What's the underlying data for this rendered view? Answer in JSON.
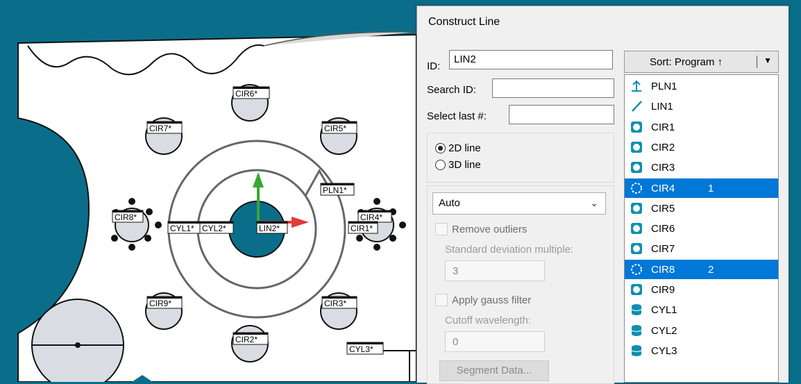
{
  "cad_view": {
    "feature_labels": [
      "CIR6*",
      "CIR7*",
      "CIR5*",
      "PLN1*",
      "CIR8*",
      "CYL1*",
      "CYL2*",
      "LIN2*",
      "CIR4*",
      "CIR1*",
      "CIR9*",
      "CIR3*",
      "CIR2*",
      "CYL3*"
    ]
  },
  "dialog": {
    "title": "Construct Line",
    "id_label": "ID:",
    "id_value": "LIN2",
    "search_label": "Search ID:",
    "search_value": "",
    "select_last_label": "Select last #:",
    "select_last_value": "",
    "radio_2d": "2D line",
    "radio_3d": "3D line",
    "selected_mode": "2D line",
    "fit_method": "Auto",
    "remove_outliers": "Remove outliers",
    "std_dev_label": "Standard deviation multiple:",
    "std_dev_value": "3",
    "gauss_filter": "Apply gauss filter",
    "cutoff_label": "Cutoff wavelength:",
    "cutoff_value": "0",
    "segment_button": "Segment Data...",
    "sort_label": "Sort: Program ↑"
  },
  "features": [
    {
      "name": "PLN1",
      "icon": "plane-icon",
      "order": "",
      "selected": false
    },
    {
      "name": "LIN1",
      "icon": "line-icon",
      "order": "",
      "selected": false
    },
    {
      "name": "CIR1",
      "icon": "circle-icon",
      "order": "",
      "selected": false
    },
    {
      "name": "CIR2",
      "icon": "circle-icon",
      "order": "",
      "selected": false
    },
    {
      "name": "CIR3",
      "icon": "circle-icon",
      "order": "",
      "selected": false
    },
    {
      "name": "CIR4",
      "icon": "circle-icon",
      "order": "1",
      "selected": true
    },
    {
      "name": "CIR5",
      "icon": "circle-icon",
      "order": "",
      "selected": false
    },
    {
      "name": "CIR6",
      "icon": "circle-icon",
      "order": "",
      "selected": false
    },
    {
      "name": "CIR7",
      "icon": "circle-icon",
      "order": "",
      "selected": false
    },
    {
      "name": "CIR8",
      "icon": "circle-icon",
      "order": "2",
      "selected": true
    },
    {
      "name": "CIR9",
      "icon": "circle-icon",
      "order": "",
      "selected": false
    },
    {
      "name": "CYL1",
      "icon": "cylinder-icon",
      "order": "",
      "selected": false
    },
    {
      "name": "CYL2",
      "icon": "cylinder-icon",
      "order": "",
      "selected": false
    },
    {
      "name": "CYL3",
      "icon": "cylinder-icon",
      "order": "",
      "selected": false
    }
  ],
  "colors": {
    "accent": "#0078d7",
    "cad_background": "#0a6e8a",
    "feature_icon": "#0e8fb0"
  }
}
